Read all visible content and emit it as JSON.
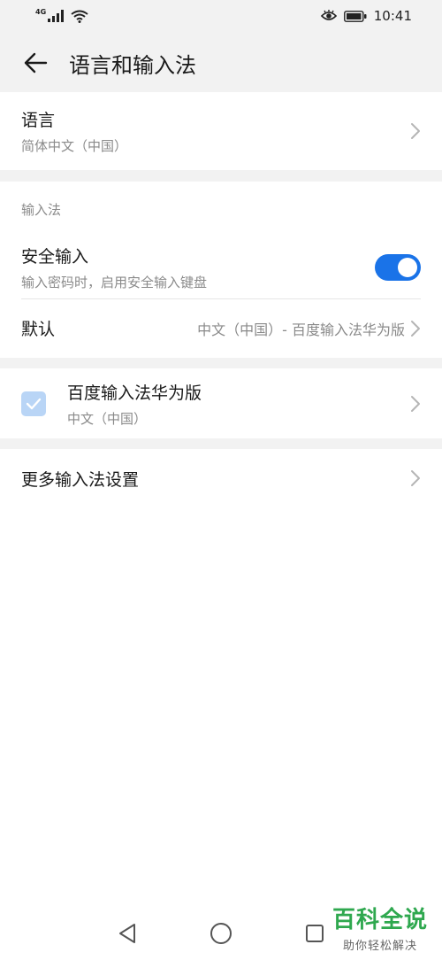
{
  "status_bar": {
    "network_type": "4G",
    "time": "10:41"
  },
  "header": {
    "title": "语言和输入法"
  },
  "language": {
    "title": "语言",
    "value": "简体中文（中国）"
  },
  "input_section": {
    "label": "输入法",
    "secure_input": {
      "title": "安全输入",
      "subtitle": "输入密码时，启用安全输入键盘",
      "enabled": true
    },
    "default": {
      "title": "默认",
      "value": "中文（中国）- 百度输入法华为版"
    }
  },
  "keyboard": {
    "name": "百度输入法华为版",
    "language": "中文（中国）",
    "checked": true
  },
  "more_settings": {
    "title": "更多输入法设置"
  },
  "watermark": {
    "title": "百科全说",
    "subtitle": "助你轻松解决"
  },
  "colors": {
    "accent": "#1a73e8",
    "background": "#f2f2f2",
    "checkbox": "#b9d5f6",
    "watermark": "#2fa84f"
  }
}
